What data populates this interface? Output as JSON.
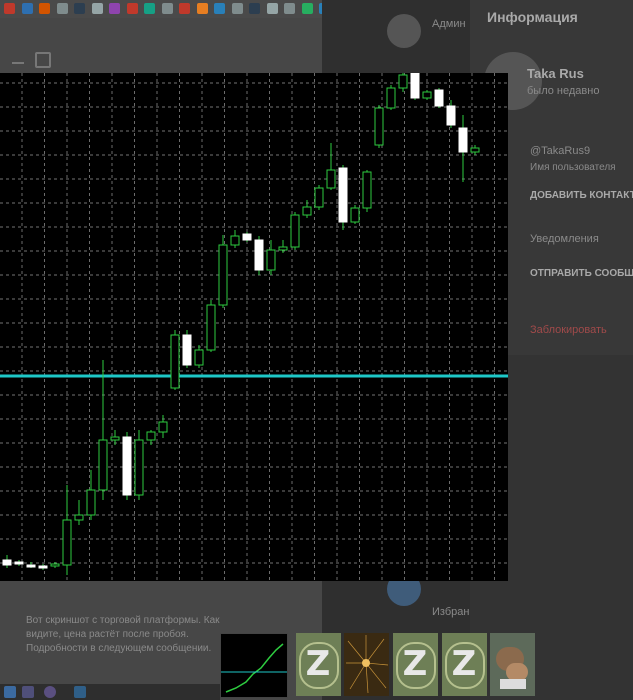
{
  "window": {
    "info_title": "Информация"
  },
  "profile": {
    "name": "Taka Rus",
    "status": "было недавно",
    "username": "@TakaRus9",
    "username_caption": "Имя пользователя"
  },
  "actions": {
    "add_contact": "ДОБАВИТЬ КОНТАКТ",
    "notifications": "Уведомления",
    "send_message": "ОТПРАВИТЬ СООБЩЕНИЕ",
    "block": "Заблокировать"
  },
  "contacts": {
    "first_name": "Админ",
    "favorites": "Избранное"
  },
  "chat": {
    "message_text": "Вот скриншот с торговой платформы. Как видите, цена растёт после пробоя. Подробности в следующем сообщении."
  },
  "icons": {
    "download": "download-icon",
    "upload": "upload-icon",
    "avatar": "avatar-icon"
  },
  "chart_data": {
    "type": "candlestick",
    "bull_color": "#2ecc40",
    "bear_color": "#ffffff",
    "horizontal_line_color": "#1ec8c8",
    "grid": true,
    "candles": [
      {
        "o": 560,
        "h": 555,
        "l": 568,
        "c": 565
      },
      {
        "o": 562,
        "h": 560,
        "l": 566,
        "c": 564
      },
      {
        "o": 565,
        "h": 562,
        "l": 568,
        "c": 567
      },
      {
        "o": 566,
        "h": 564,
        "l": 570,
        "c": 568
      },
      {
        "o": 566,
        "h": 562,
        "l": 568,
        "c": 564
      },
      {
        "o": 565,
        "h": 485,
        "l": 575,
        "c": 520
      },
      {
        "o": 520,
        "h": 500,
        "l": 525,
        "c": 515
      },
      {
        "o": 515,
        "h": 470,
        "l": 520,
        "c": 490
      },
      {
        "o": 490,
        "h": 360,
        "l": 500,
        "c": 440
      },
      {
        "o": 440,
        "h": 430,
        "l": 445,
        "c": 437
      },
      {
        "o": 437,
        "h": 432,
        "l": 500,
        "c": 495
      },
      {
        "o": 495,
        "h": 430,
        "l": 500,
        "c": 440
      },
      {
        "o": 440,
        "h": 430,
        "l": 445,
        "c": 432
      },
      {
        "o": 432,
        "h": 415,
        "l": 438,
        "c": 422
      },
      {
        "o": 388,
        "h": 330,
        "l": 390,
        "c": 335
      },
      {
        "o": 335,
        "h": 330,
        "l": 368,
        "c": 365
      },
      {
        "o": 365,
        "h": 345,
        "l": 368,
        "c": 350
      },
      {
        "o": 350,
        "h": 300,
        "l": 352,
        "c": 305
      },
      {
        "o": 305,
        "h": 235,
        "l": 308,
        "c": 245
      },
      {
        "o": 245,
        "h": 230,
        "l": 248,
        "c": 236
      },
      {
        "o": 234,
        "h": 232,
        "l": 242,
        "c": 240
      },
      {
        "o": 240,
        "h": 236,
        "l": 275,
        "c": 270
      },
      {
        "o": 270,
        "h": 240,
        "l": 275,
        "c": 250
      },
      {
        "o": 250,
        "h": 240,
        "l": 253,
        "c": 247
      },
      {
        "o": 247,
        "h": 212,
        "l": 250,
        "c": 215
      },
      {
        "o": 215,
        "h": 200,
        "l": 218,
        "c": 207
      },
      {
        "o": 207,
        "h": 185,
        "l": 210,
        "c": 188
      },
      {
        "o": 188,
        "h": 143,
        "l": 190,
        "c": 170
      },
      {
        "o": 168,
        "h": 165,
        "l": 230,
        "c": 222
      },
      {
        "o": 222,
        "h": 205,
        "l": 224,
        "c": 208
      },
      {
        "o": 208,
        "h": 170,
        "l": 212,
        "c": 172
      },
      {
        "o": 145,
        "h": 105,
        "l": 148,
        "c": 108
      },
      {
        "o": 108,
        "h": 85,
        "l": 110,
        "c": 88
      },
      {
        "o": 88,
        "h": 73,
        "l": 92,
        "c": 75
      },
      {
        "o": 73,
        "h": 71,
        "l": 100,
        "c": 98
      },
      {
        "o": 98,
        "h": 90,
        "l": 100,
        "c": 92
      },
      {
        "o": 90,
        "h": 88,
        "l": 108,
        "c": 106
      },
      {
        "o": 106,
        "h": 100,
        "l": 128,
        "c": 125
      },
      {
        "o": 128,
        "h": 115,
        "l": 182,
        "c": 152
      },
      {
        "o": 152,
        "h": 145,
        "l": 155,
        "c": 148
      }
    ]
  }
}
